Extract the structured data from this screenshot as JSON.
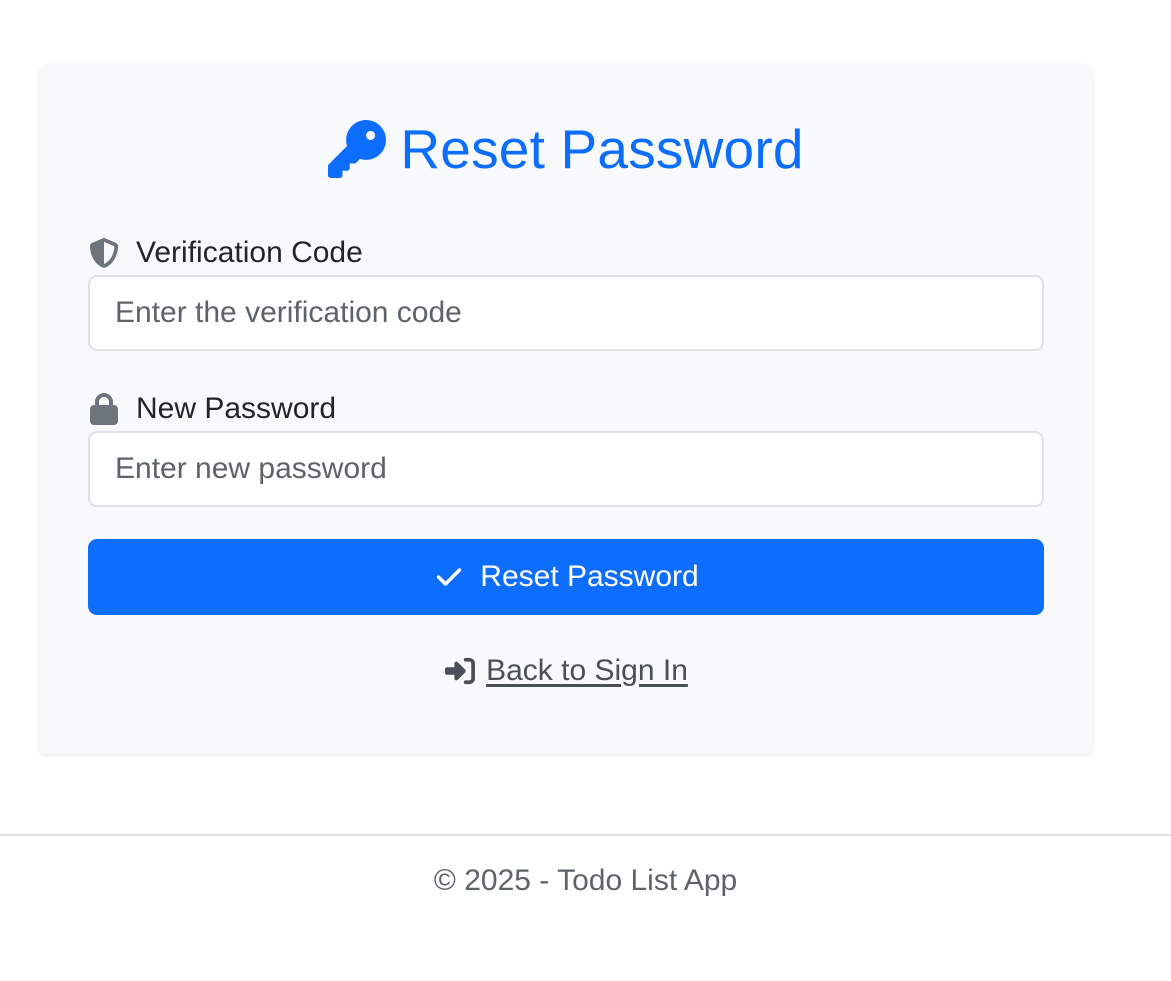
{
  "card": {
    "title": "Reset Password",
    "title_icon": "key-icon",
    "verification": {
      "label": "Verification Code",
      "icon": "shield-icon",
      "placeholder": "Enter the verification code",
      "value": ""
    },
    "new_password": {
      "label": "New Password",
      "icon": "lock-icon",
      "placeholder": "Enter new password",
      "value": ""
    },
    "submit": {
      "label": "Reset Password",
      "icon": "check-icon"
    },
    "back_link": {
      "label": " Back to Sign In",
      "icon": "sign-in-icon"
    }
  },
  "footer": {
    "text": "© 2025 - Todo List App"
  },
  "colors": {
    "primary": "#0d6efd",
    "card_background": "#f8f9fa",
    "muted_text": "#5c636a",
    "icon_gray": "#6c757d"
  }
}
